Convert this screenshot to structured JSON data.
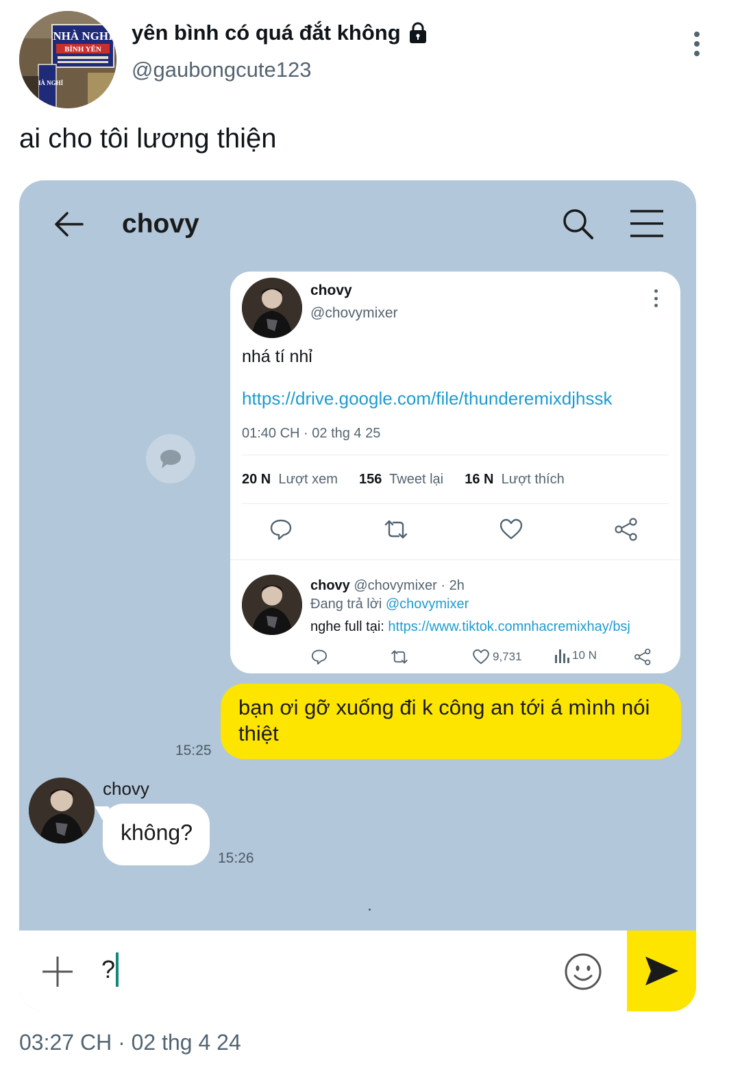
{
  "tweet": {
    "author_name": "yên bình có quá đắt không",
    "author_handle": "@gaubongcute123",
    "text": "ai cho tôi lương thiện",
    "timestamp": "03:27 CH · 02 thg 4 24",
    "avatar_sign": {
      "line1": "NHÀ NGHỈ",
      "line2": "BÌNH YÊN",
      "side": "NHÀ NGHỈ"
    }
  },
  "chat": {
    "title": "chovy",
    "shared_tweet": {
      "name": "chovy",
      "handle": "@chovymixer",
      "text": "nhá tí nhỉ",
      "link": "https://drive.google.com/file/thunderemixdjhssk",
      "time": "01:40 CH · 02 thg 4 25",
      "stats": {
        "views_value": "20 N",
        "views_label": "Lượt xem",
        "retweets_value": "156",
        "retweets_label": "Tweet lại",
        "likes_value": "16 N",
        "likes_label": "Lượt thích"
      },
      "reply": {
        "name": "chovy",
        "meta": "@chovymixer · 2h",
        "replying_prefix": "Đang trả lời",
        "replying_to": "@chovymixer",
        "text_prefix": "nghe full tại:",
        "text_link": "https://www.tiktok.comnhacremixhay/bsj",
        "like_count": "9,731",
        "view_count": "10 N"
      }
    },
    "messages": [
      {
        "direction": "out",
        "text": "bạn ơi gỡ xuống đi k công an tới á mình nói thiệt",
        "time": "15:25"
      },
      {
        "direction": "in",
        "sender": "chovy",
        "text": "không?",
        "time": "15:26"
      }
    ],
    "input_value": "?"
  },
  "colors": {
    "chat_background": "#b2c7da",
    "outgoing_bubble": "#fee500",
    "link": "#1d9bd0",
    "secondary_text": "#536471"
  },
  "icons": [
    "lock-icon",
    "more-vertical-icon",
    "back-arrow-icon",
    "search-icon",
    "menu-icon",
    "speech-bubble-icon",
    "reply-icon",
    "retweet-icon",
    "like-icon",
    "share-icon",
    "views-icon",
    "plus-icon",
    "emoji-icon",
    "send-icon"
  ]
}
